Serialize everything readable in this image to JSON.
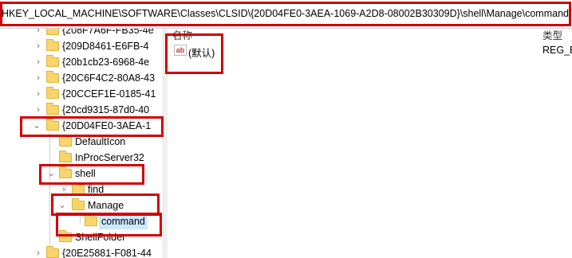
{
  "address": {
    "path": "HKEY_LOCAL_MACHINE\\SOFTWARE\\Classes\\CLSID\\{20D04FE0-3AEA-1069-A2D8-08002B30309D}\\shell\\Manage\\command"
  },
  "tree": {
    "rows": [
      {
        "label": "{208F7A6F-FB35-4e",
        "expander": ">"
      },
      {
        "label": "{209D8461-E6FB-4",
        "expander": ">"
      },
      {
        "label": "{20b1cb23-6968-4e",
        "expander": ">"
      },
      {
        "label": "{20C6F4C2-80A8-43",
        "expander": ">"
      },
      {
        "label": "{20CCEF1E-0185-41",
        "expander": ">"
      },
      {
        "label": "{20cd9315-87d0-40",
        "expander": ">"
      },
      {
        "label": "{20D04FE0-3AEA-1",
        "expander": "v"
      },
      {
        "label": "DefaultIcon",
        "expander": ""
      },
      {
        "label": "InProcServer32",
        "expander": ""
      },
      {
        "label": "shell",
        "expander": "v"
      },
      {
        "label": "find",
        "expander": ">"
      },
      {
        "label": "Manage",
        "expander": "v"
      },
      {
        "label": "command",
        "expander": ""
      },
      {
        "label": "ShellFolder",
        "expander": ""
      },
      {
        "label": "{20E25881-F081-44",
        "expander": ">"
      }
    ]
  },
  "list": {
    "header_name": "名称",
    "header_type": "类型",
    "values": [
      {
        "name": "(默认)",
        "type": "REG_EX",
        "icon": "string-value-icon"
      }
    ]
  },
  "colors": {
    "highlight": "#d20000",
    "selection": "#cce8ff",
    "folder": "#f7d56a"
  }
}
